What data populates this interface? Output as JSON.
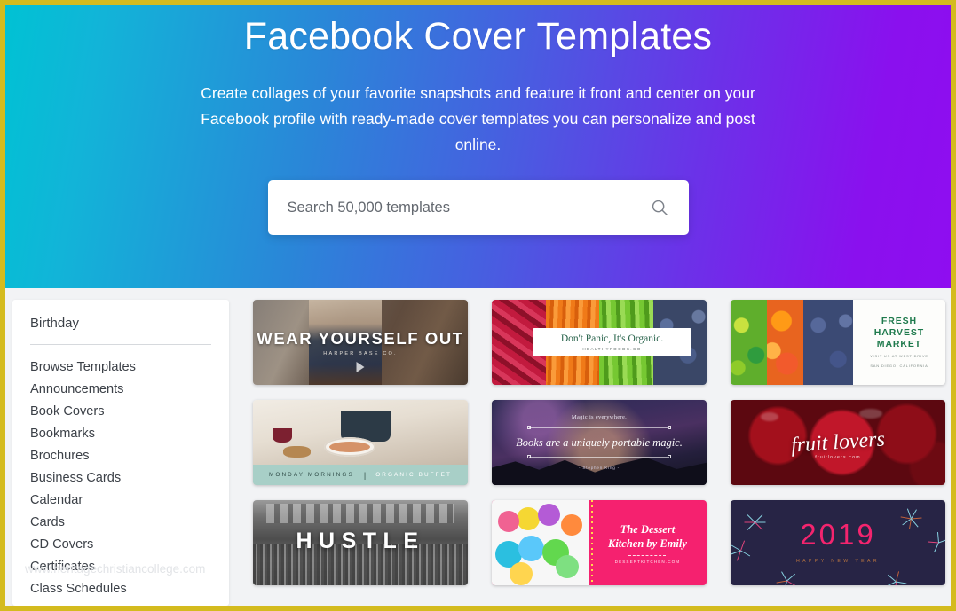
{
  "hero": {
    "title": "Facebook Cover Templates",
    "subtitle": "Create collages of your favorite snapshots and feature it front and center on your Facebook profile with ready-made cover templates you can personalize and post online.",
    "gradient_start": "#00c2d4",
    "gradient_end": "#8f0df0"
  },
  "search": {
    "placeholder": "Search 50,000 templates",
    "value": "",
    "icon": "search-icon"
  },
  "sidebar": {
    "title": "Birthday",
    "watermark": "www.heritagechristiancollege.com",
    "items": [
      {
        "label": "Browse Templates"
      },
      {
        "label": "Announcements"
      },
      {
        "label": "Book Covers"
      },
      {
        "label": "Bookmarks"
      },
      {
        "label": "Brochures"
      },
      {
        "label": "Business Cards"
      },
      {
        "label": "Calendar"
      },
      {
        "label": "Cards"
      },
      {
        "label": "CD Covers"
      },
      {
        "label": "Certificates"
      },
      {
        "label": "Class Schedules"
      }
    ]
  },
  "templates": [
    {
      "id": "wear-yourself-out",
      "headline": "WEAR YOURSELF OUT",
      "subtext": "HARPER BASE CO."
    },
    {
      "id": "dont-panic-its-organic",
      "headline": "Don't Panic, It's Organic.",
      "subtext": "HEALTHYFOODS.CO"
    },
    {
      "id": "fresh-harvest-market",
      "headline_line1": "FRESH",
      "headline_line2": "HARVEST",
      "headline_line3": "MARKET",
      "subtext_line1": "VISIT US AT WEST DRIVE",
      "subtext_line2": "SAN DIEGO, CALIFORNIA"
    },
    {
      "id": "monday-mornings",
      "headline": "MONDAY MORNINGS",
      "separator": "|",
      "subtext": "ORGANIC BUFFET"
    },
    {
      "id": "books-portable-magic",
      "eyebrow": "Magic is everywhere.",
      "headline": "Books are a uniquely portable magic.",
      "attribution": "- Stephen King -"
    },
    {
      "id": "fruit-lovers",
      "headline": "fruit lovers",
      "subtext": "fruitlovers.com"
    },
    {
      "id": "hustle",
      "headline": "HUSTLE"
    },
    {
      "id": "dessert-kitchen-by-emily",
      "headline_line1": "The Dessert",
      "headline_line2": "Kitchen by Emily",
      "subtext": "DESSERTKITCHEN.COM"
    },
    {
      "id": "happy-new-year-2019",
      "headline": "2019",
      "subtext": "HAPPY NEW YEAR"
    }
  ],
  "colors": {
    "page_border": "#d4bb1e",
    "page_background": "#f2f3f5",
    "card_surface": "#ffffff",
    "text_primary": "#3c4148",
    "accent_pink": "#f5216f",
    "accent_green": "#1f7a4d"
  }
}
